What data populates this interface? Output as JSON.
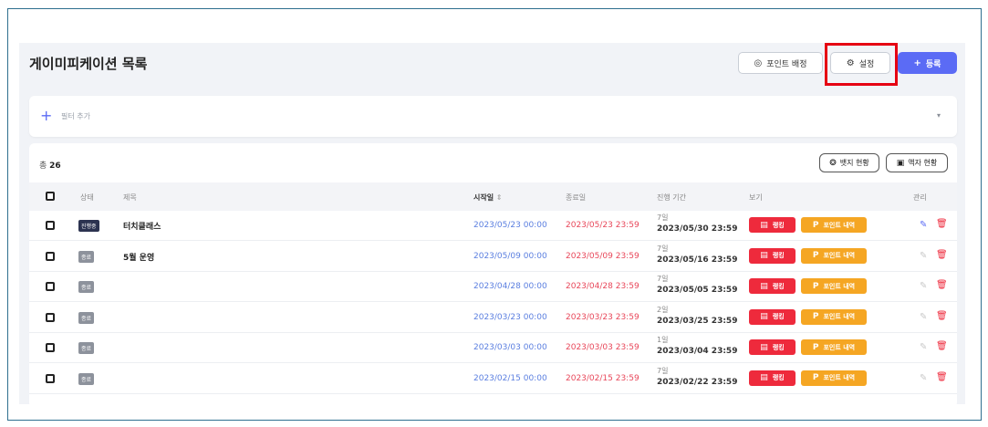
{
  "header": {
    "title": "게이미피케이션 목록",
    "point_button": "포인트 배정",
    "settings_button": "설정",
    "register_button": "등록"
  },
  "filter": {
    "add_label": "필터 추가"
  },
  "table": {
    "total_label": "총",
    "total_count": "26",
    "badge_button": "뱃지 현황",
    "frame_button": "액자 현황",
    "columns": {
      "status": "상태",
      "title": "제목",
      "start": "시작일",
      "end": "종료일",
      "period": "진행 기간",
      "view": "보기",
      "manage": "관리"
    },
    "rank_label": "랭킹",
    "points_label": "포인트 내역",
    "rows": [
      {
        "status": "진행중",
        "status_type": "active",
        "title": "터치클래스",
        "start": "2023/05/23 00:00",
        "end": "2023/05/23 23:59",
        "duration": "7일",
        "period_end": "2023/05/30 23:59"
      },
      {
        "status": "종료",
        "status_type": "done",
        "title": "5월 운영",
        "start": "2023/05/09 00:00",
        "end": "2023/05/09 23:59",
        "duration": "7일",
        "period_end": "2023/05/16 23:59"
      },
      {
        "status": "종료",
        "status_type": "done",
        "title": "",
        "start": "2023/04/28 00:00",
        "end": "2023/04/28 23:59",
        "duration": "7일",
        "period_end": "2023/05/05 23:59"
      },
      {
        "status": "종료",
        "status_type": "done",
        "title": "",
        "start": "2023/03/23 00:00",
        "end": "2023/03/23 23:59",
        "duration": "2일",
        "period_end": "2023/03/25 23:59"
      },
      {
        "status": "종료",
        "status_type": "done",
        "title": "",
        "start": "2023/03/03 00:00",
        "end": "2023/03/03 23:59",
        "duration": "1일",
        "period_end": "2023/03/04 23:59"
      },
      {
        "status": "종료",
        "status_type": "done",
        "title": "",
        "start": "2023/02/15 00:00",
        "end": "2023/02/15 23:59",
        "duration": "7일",
        "period_end": "2023/02/22 23:59"
      }
    ]
  },
  "colors": {
    "accent": "#5b6bf5",
    "start_date": "#5b7fe0",
    "end_date": "#e8475a",
    "rank": "#ee2a3c",
    "points": "#f5a623",
    "highlight": "#e60012"
  }
}
